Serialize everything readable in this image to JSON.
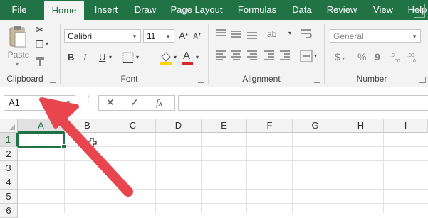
{
  "tabs": [
    "File",
    "Home",
    "Insert",
    "Draw",
    "Page Layout",
    "Formulas",
    "Data",
    "Review",
    "View",
    "Help"
  ],
  "ribbon": {
    "clipboard": {
      "paste_label": "Paste",
      "group_label": "Clipboard"
    },
    "font": {
      "font_name": "Calibri",
      "font_size": "11",
      "bold": "B",
      "italic": "I",
      "underline": "U",
      "font_color_letter": "A",
      "grow": "A",
      "shrink": "A",
      "group_label": "Font",
      "font_color": "#d62828"
    },
    "alignment": {
      "group_label": "Alignment"
    },
    "number": {
      "format": "General",
      "currency": "$",
      "percent": "%",
      "comma": "9",
      "group_label": "Number"
    }
  },
  "formula_bar": {
    "name_box": "A1",
    "cancel": "✕",
    "enter": "✓",
    "fx": "fx",
    "content": ""
  },
  "columns": [
    "A",
    "B",
    "C",
    "D",
    "E",
    "F",
    "G",
    "H",
    "I"
  ],
  "rows": [
    "1",
    "2",
    "3",
    "4",
    "5",
    "6"
  ],
  "selected_cell": "A1",
  "colors": {
    "accent": "#217346",
    "arrow": "#e8454f"
  }
}
